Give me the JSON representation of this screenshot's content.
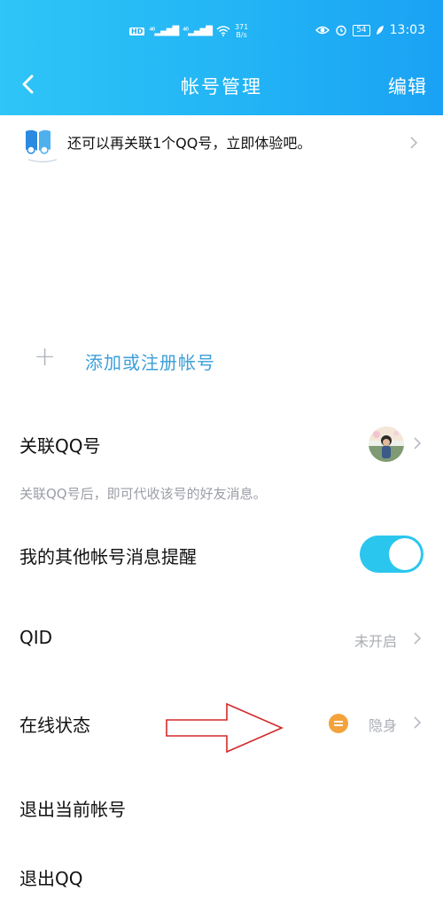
{
  "status_bar": {
    "hd": "HD",
    "signal_1": "⁴⁶",
    "signal_2": "⁴⁶",
    "net_speed_value": "371",
    "net_speed_unit": "B/s",
    "battery": "54",
    "time": "13:03"
  },
  "nav": {
    "title": "帐号管理",
    "edit_label": "编辑"
  },
  "promo": {
    "text": "还可以再关联1个QQ号，立即体验吧。"
  },
  "add_account": {
    "label": "添加或注册帐号",
    "icon": "plus-icon"
  },
  "settings": {
    "linked_qq": {
      "label": "关联QQ号",
      "hint": "关联QQ号后，即可代收该号的好友消息。"
    },
    "other_account_alerts": {
      "label": "我的其他帐号消息提醒",
      "enabled": true
    },
    "qid": {
      "label": "QID",
      "value": "未开启"
    },
    "online_status": {
      "label": "在线状态",
      "value": "隐身",
      "indicator_color": "#f3a23c"
    },
    "logout_current": {
      "label": "退出当前帐号"
    },
    "exit_qq": {
      "label": "退出QQ"
    }
  },
  "colors": {
    "header_start": "#2fc5f7",
    "header_end": "#1aa2f4",
    "accent_blue": "#3c9fd8",
    "toggle_on": "#2bc6ee",
    "annotation_arrow": "#d42a2a"
  }
}
